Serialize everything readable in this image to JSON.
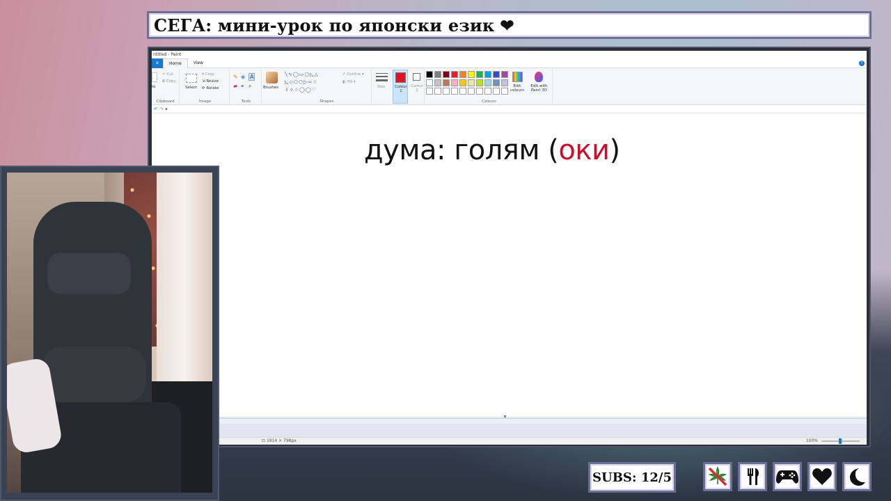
{
  "overlay": {
    "title": "СЕГА: мини-урок по японски език",
    "title_heart": "❤",
    "subs_label": "SUBS: 12/5",
    "status_icons": [
      "no-weed-icon",
      "fork-knife-icon",
      "gamepad-icon",
      "heart-icon",
      "moon-icon"
    ]
  },
  "paint": {
    "window_title": "ntitled - Paint",
    "tabs": {
      "home": "Home",
      "view": "View"
    },
    "ribbon": {
      "clipboard": {
        "label": "Clipboard",
        "paste": "te",
        "cut": "Cut",
        "copy": "Copy"
      },
      "image": {
        "label": "Image",
        "select": "Select",
        "crop": "Crop",
        "resize": "Resize",
        "rotate": "Rotate"
      },
      "tools": {
        "label": "Tools"
      },
      "brushes": "Brushes",
      "shapes": {
        "label": "Shapes",
        "outline": "Outline",
        "fill": "Fill"
      },
      "size": "Size",
      "colour1": "Colour 1",
      "colour2": "Colour 2",
      "colours": {
        "label": "Colours",
        "edit": "Edit colours",
        "paint3d": "Edit with Paint 3D"
      }
    },
    "palette_row1": [
      "#000000",
      "#7f7f7f",
      "#880015",
      "#ed1c24",
      "#ff7f27",
      "#fff200",
      "#22b14c",
      "#00a2e8",
      "#3f48cc",
      "#a349a4"
    ],
    "palette_row2": [
      "#ffffff",
      "#c3c3c3",
      "#b97a57",
      "#ffaec9",
      "#ffc90e",
      "#efe4b0",
      "#b5e61d",
      "#99d9ea",
      "#7092be",
      "#c8bfe7"
    ],
    "colour1_value": "#e81123",
    "canvas_text": {
      "part1": "дума: голям (",
      "red": "оки",
      "part2": ")"
    },
    "status": {
      "dimensions": "1914 × 798px",
      "zoom": "100%"
    }
  }
}
